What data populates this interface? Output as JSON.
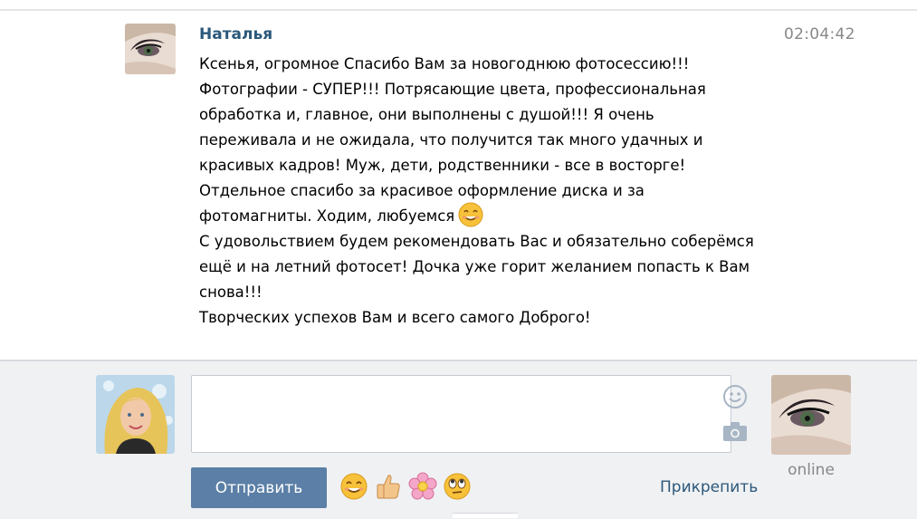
{
  "message": {
    "sender": "Наталья",
    "time": "02:04:42",
    "lines": [
      "Ксенья, огромное Спасибо Вам за новогоднюю фотосессию!!!",
      "Фотографии - СУПЕР!!! Потрясающие цвета, профессиональная",
      "обработка и, главное, они выполнены с душой!!! Я очень",
      "переживала и не ожидала, что получится так много удачных и",
      "красивых кадров! Муж, дети, родственники - все в восторге!",
      "Отдельное спасибо за красивое оформление диска и за",
      "фотомагниты. Ходим, любуемся",
      "С удовольствием будем рекомендовать Вас и обязательно соберёмся",
      "ещё и на летний фотосет! Дочка уже горит желанием попасть к Вам",
      "снова!!!",
      "Творческих успехов Вам и всего самого Доброго!"
    ]
  },
  "compose": {
    "input_value": "",
    "send_label": "Отправить",
    "attach_label": "Прикрепить",
    "peer_status": "online",
    "quick_emoji": [
      "smile-emoji",
      "thumbs-up-emoji",
      "flower-emoji",
      "rolling-eyes-emoji"
    ]
  },
  "colors": {
    "name_link": "#2b587a",
    "send_button": "#5b7fa6",
    "compose_bg": "#f0f1f3",
    "muted_text": "#888888"
  }
}
